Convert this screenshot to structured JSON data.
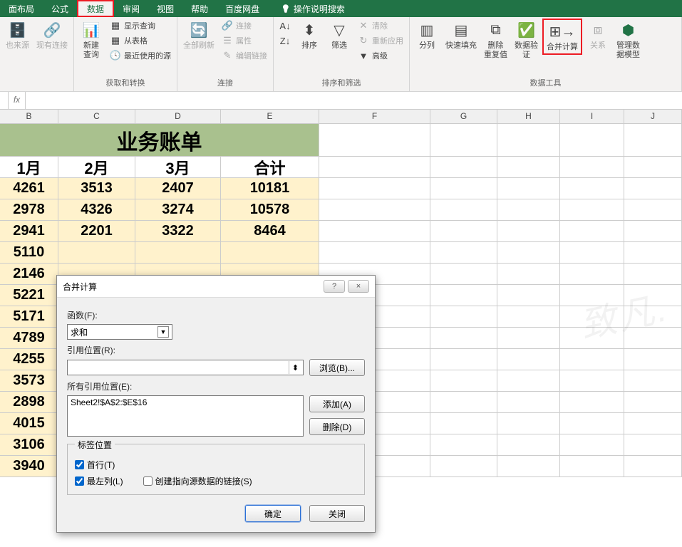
{
  "menubar": {
    "tabs": [
      "面布局",
      "公式",
      "数据",
      "审阅",
      "视图",
      "帮助",
      "百度网盘"
    ],
    "active_index": 2,
    "search_hint": "操作说明搜索"
  },
  "ribbon": {
    "group1": {
      "label": "",
      "btn1": "也来源",
      "btn2": "现有连接"
    },
    "group2": {
      "label": "获取和转换",
      "btn_newquery": "新建\n查询",
      "small": [
        "显示查询",
        "从表格",
        "最近使用的源"
      ]
    },
    "group3": {
      "label": "连接",
      "btn_refresh": "全部刷新",
      "small": [
        "连接",
        "属性",
        "编辑链接"
      ]
    },
    "group4": {
      "label": "排序和筛选",
      "sort_asc": "A↓Z",
      "sort_desc": "Z↓A",
      "btn_sort": "排序",
      "btn_filter": "筛选",
      "small": [
        "清除",
        "重新应用",
        "高级"
      ]
    },
    "group5": {
      "label": "数据工具",
      "btns": [
        "分列",
        "快速填充",
        "删除\n重复值",
        "数据验\n证",
        "合并计算",
        "关系",
        "管理数\n据模型"
      ]
    }
  },
  "formula_bar": {
    "fx": "fx",
    "value": ""
  },
  "grid": {
    "columns": [
      "B",
      "C",
      "D",
      "E",
      "F",
      "G",
      "H",
      "I",
      "J"
    ],
    "title": "业务账单",
    "headers": [
      "1月",
      "2月",
      "3月",
      "合计"
    ],
    "rows": [
      [
        "4261",
        "3513",
        "2407",
        "10181"
      ],
      [
        "2978",
        "4326",
        "3274",
        "10578"
      ],
      [
        "2941",
        "2201",
        "3322",
        "8464"
      ],
      [
        "5110",
        "",
        "",
        "",
        "blur"
      ],
      [
        "2146"
      ],
      [
        "5221"
      ],
      [
        "5171"
      ],
      [
        "4789"
      ],
      [
        "4255"
      ],
      [
        "3573"
      ],
      [
        "2898"
      ],
      [
        "4015"
      ],
      [
        "3106"
      ],
      [
        "3940"
      ]
    ]
  },
  "dialog": {
    "title": "合并计算",
    "help": "?",
    "close": "×",
    "function_label": "函数(F):",
    "function_value": "求和",
    "ref_label": "引用位置(R):",
    "ref_value": "",
    "browse_btn": "浏览(B)...",
    "all_refs_label": "所有引用位置(E):",
    "all_refs_list": [
      "Sheet2!$A$2:$E$16"
    ],
    "add_btn": "添加(A)",
    "delete_btn": "删除(D)",
    "labels_group": "标签位置",
    "top_row_chk": "首行(T)",
    "left_col_chk": "最左列(L)",
    "link_chk": "创建指向源数据的链接(S)",
    "ok": "确定",
    "cancel": "关闭"
  },
  "watermark": "致凡."
}
